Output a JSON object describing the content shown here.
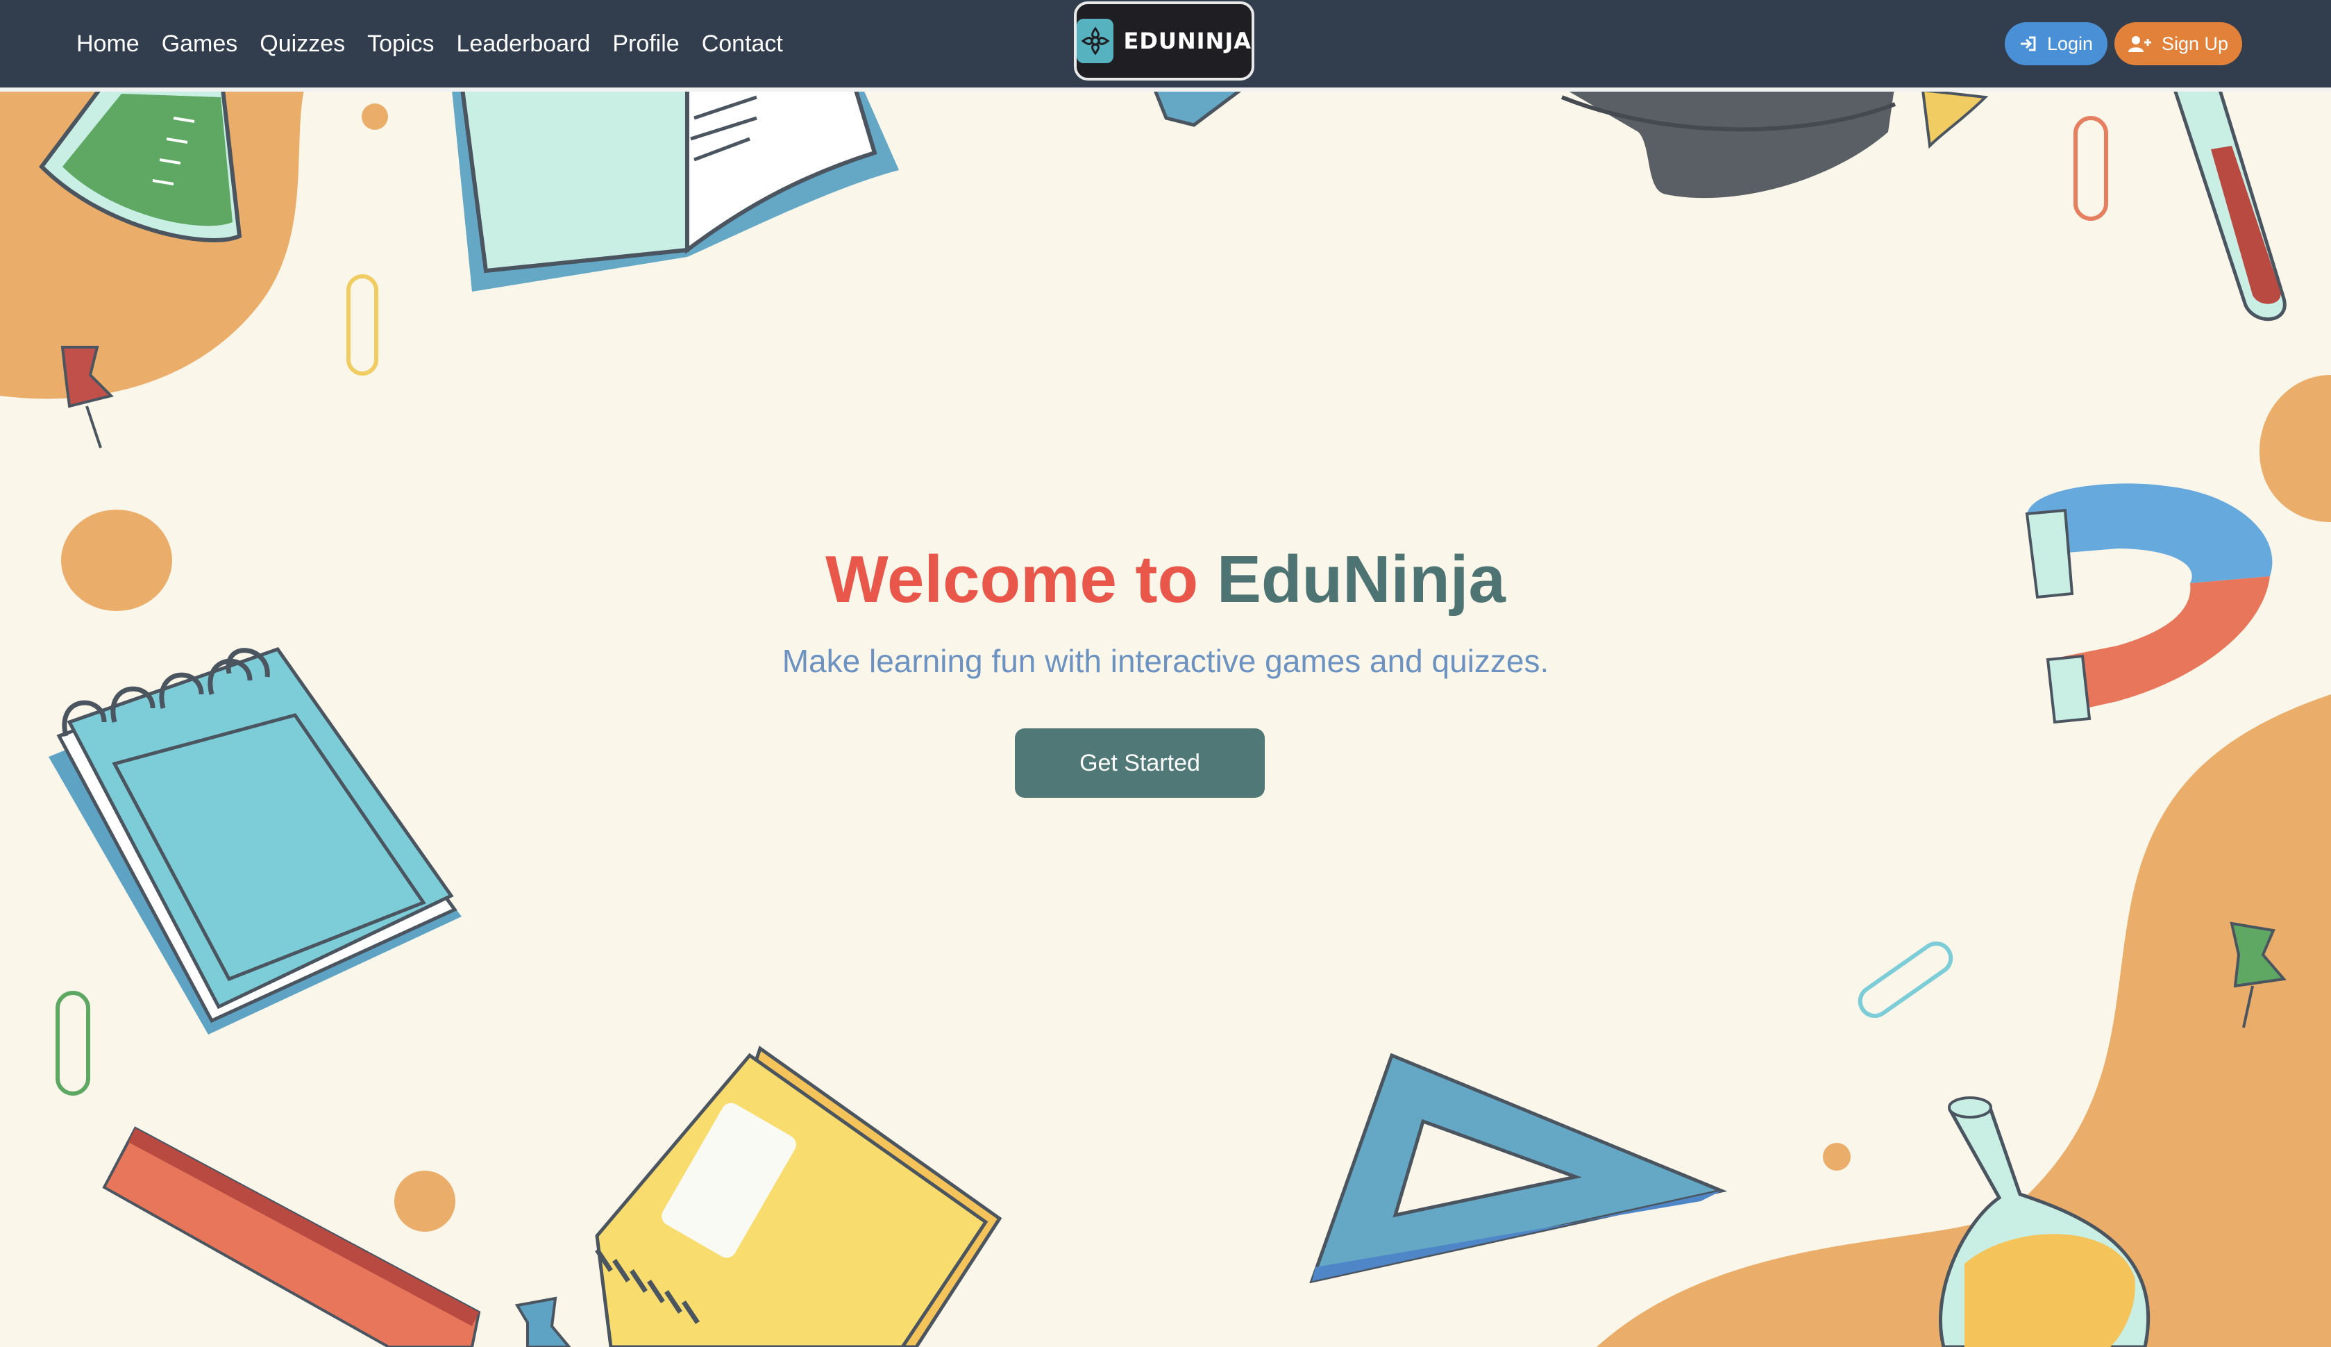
{
  "nav": {
    "links": [
      "Home",
      "Games",
      "Quizzes",
      "Topics",
      "Leaderboard",
      "Profile",
      "Contact"
    ]
  },
  "brand": {
    "logo_text": "EDUNINJA"
  },
  "auth": {
    "login_label": "Login",
    "signup_label": "Sign Up"
  },
  "hero": {
    "title_part1": "Welcome to",
    "title_part2": "EduNinja",
    "subtitle": "Make learning fun with interactive games and quizzes.",
    "cta_label": "Get Started"
  },
  "colors": {
    "navbar_bg": "#323e4e",
    "page_bg": "#fbf6ea",
    "title_accent": "#e8574a",
    "title_brand": "#4d7472",
    "subtitle": "#6b92c1",
    "cta_bg": "#507877",
    "login_bg": "#4a90d6",
    "signup_bg": "#e2823a",
    "blob": "#eaae6a"
  },
  "icons": [
    "login-icon",
    "user-plus-icon",
    "ninja-star-icon"
  ]
}
